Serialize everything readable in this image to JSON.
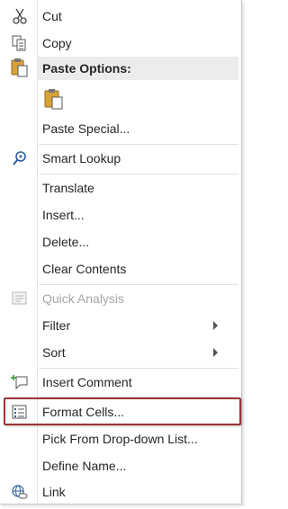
{
  "menu": {
    "items": [
      {
        "label": "Cut",
        "icon": "scissors-icon"
      },
      {
        "label": "Copy",
        "icon": "copy-icon"
      },
      {
        "label": "Paste Options:",
        "icon": "clipboard-icon"
      },
      {
        "label": "",
        "icon": "paste-icon"
      },
      {
        "label": "Paste Special...",
        "icon": ""
      },
      {
        "label": "Smart Lookup",
        "icon": "search-icon"
      },
      {
        "label": "Translate",
        "icon": ""
      },
      {
        "label": "Insert...",
        "icon": ""
      },
      {
        "label": "Delete...",
        "icon": ""
      },
      {
        "label": "Clear Contents",
        "icon": ""
      },
      {
        "label": "Quick Analysis",
        "icon": "quick-analysis-icon",
        "disabled": true
      },
      {
        "label": "Filter",
        "icon": "",
        "submenu": true
      },
      {
        "label": "Sort",
        "icon": "",
        "submenu": true
      },
      {
        "label": "Insert Comment",
        "icon": "comment-icon"
      },
      {
        "label": "Format Cells...",
        "icon": "format-cells-icon",
        "highlighted": true
      },
      {
        "label": "Pick From Drop-down List...",
        "icon": ""
      },
      {
        "label": "Define Name...",
        "icon": ""
      },
      {
        "label": "Link",
        "icon": "link-icon"
      }
    ]
  },
  "colors": {
    "highlight_border": "#9b3434",
    "disabled_text": "#a6a6a6",
    "header_bg": "#ececec"
  }
}
